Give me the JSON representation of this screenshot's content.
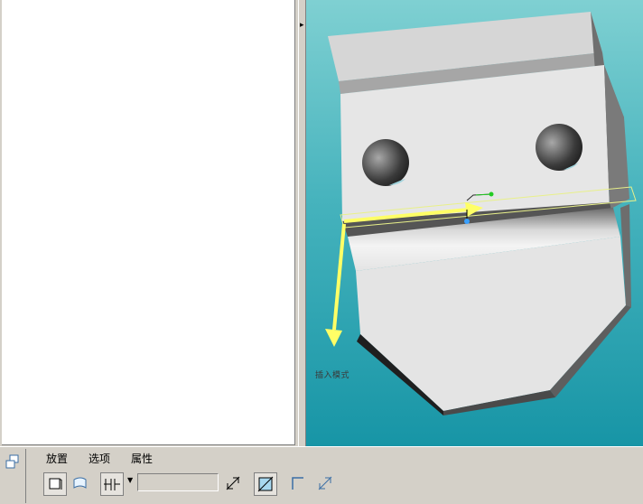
{
  "dashboard": {
    "tabs": [
      {
        "label": "放置"
      },
      {
        "label": "选项"
      },
      {
        "label": "属性"
      }
    ],
    "depth_value": "",
    "icons": [
      "extrude-type-icon",
      "surface-icon",
      "depth-option-icon",
      "flip-direction-icon",
      "remove-material-icon",
      "thicken-icon",
      "flip-thicken-icon"
    ]
  },
  "viewport": {
    "annotation": "插入模式",
    "colors": {
      "background_top": "#7fd0d2",
      "background_bottom": "#1795a6",
      "part_face": "#e4e4e4",
      "arrow": "#ffff66"
    }
  }
}
